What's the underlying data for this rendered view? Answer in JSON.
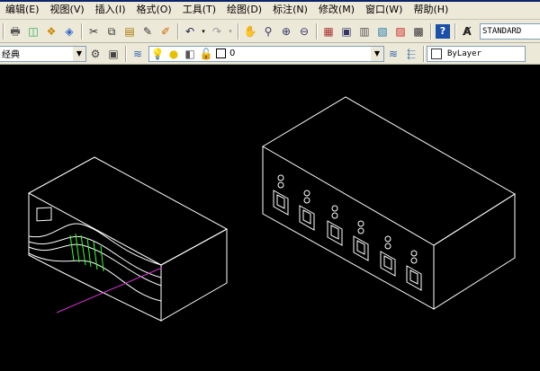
{
  "menu": {
    "items": [
      "编辑(E)",
      "视图(V)",
      "插入(I)",
      "格式(O)",
      "工具(T)",
      "绘图(D)",
      "标注(N)",
      "修改(M)",
      "窗口(W)",
      "帮助(H)"
    ]
  },
  "toolbar1": {
    "text_style_value": "STANDARD",
    "icons": [
      "print-icon",
      "preview-icon",
      "publish-icon",
      "plot-icon",
      "cut-icon",
      "copy-icon",
      "paste-icon",
      "match-brush-icon",
      "pen-icon",
      "undo-icon",
      "redo-icon",
      "pan-icon",
      "zoom-realtime-icon",
      "zoom-window-icon",
      "zoom-previous-icon",
      "properties-icon",
      "design-center-icon",
      "tool-palettes-icon",
      "sheet-set-icon",
      "markup-icon",
      "calculator-icon",
      "help-icon",
      "text-style-icon"
    ]
  },
  "toolbar2": {
    "workspace_value": "经典",
    "layer_value": "0",
    "color_value": "ByLayer"
  },
  "colors": {
    "line_white": "#ffffff",
    "line_green": "#33ff33",
    "line_magenta": "#cc33cc",
    "ui_bg": "#ece9d8"
  }
}
